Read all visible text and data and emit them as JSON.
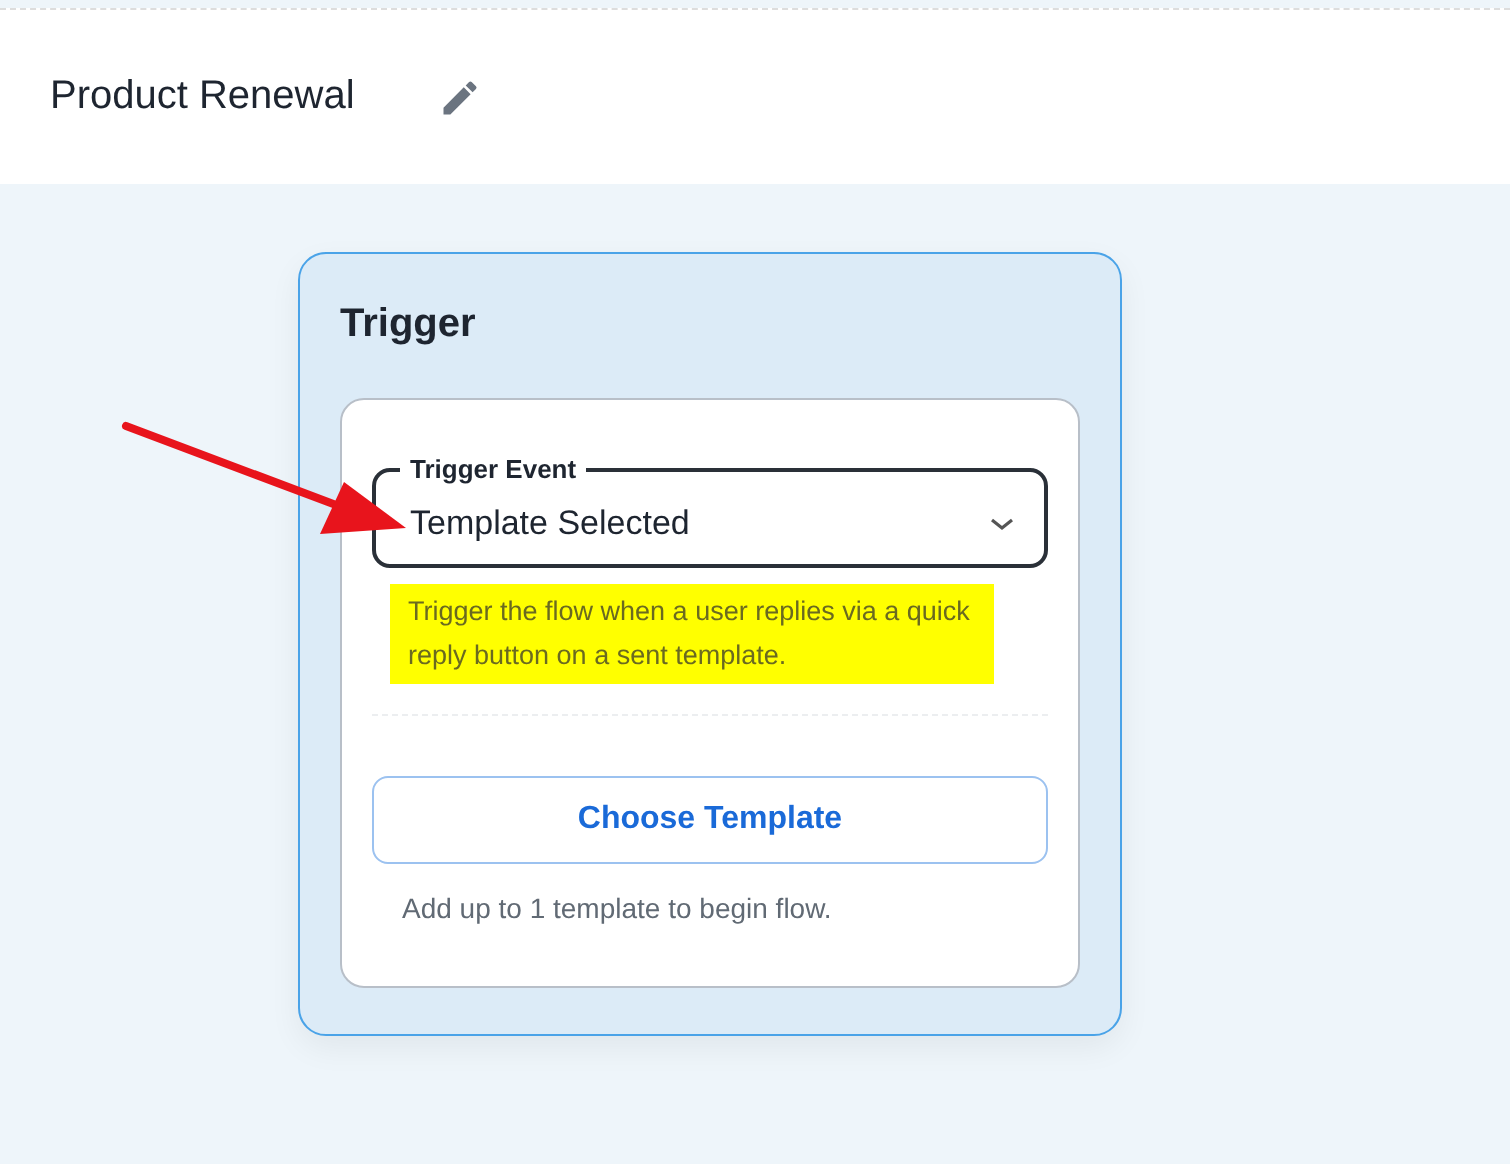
{
  "header": {
    "title": "Product Renewal"
  },
  "node": {
    "title": "Trigger",
    "select": {
      "label": "Trigger Event",
      "value": "Template Selected"
    },
    "hint": {
      "text": "Trigger the flow when a user replies via a quick reply button on a sent template.",
      "highlighted": true
    },
    "button": "Choose Template",
    "note": "Add up to 1 template to begin flow."
  },
  "annotation": {
    "arrow": true
  }
}
